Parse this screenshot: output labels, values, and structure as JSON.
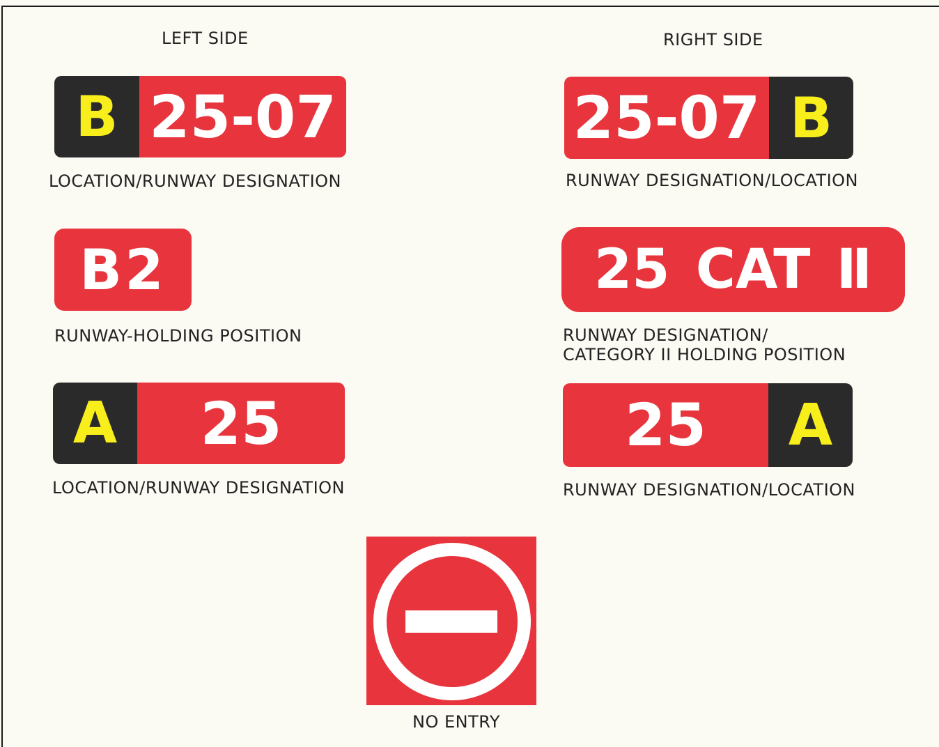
{
  "headings": {
    "left": "LEFT SIDE",
    "right": "RIGHT SIDE"
  },
  "signs": {
    "left_loc_rwy": {
      "location": "B",
      "runway": "25-07",
      "caption": "LOCATION/RUNWAY DESIGNATION"
    },
    "right_rwy_loc": {
      "runway": "25-07",
      "location": "B",
      "caption": "RUNWAY DESIGNATION/LOCATION"
    },
    "holding": {
      "text": "B2",
      "caption": "RUNWAY-HOLDING POSITION"
    },
    "cat2": {
      "text": "25 CAT Ⅱ",
      "caption_line1": "RUNWAY DESIGNATION/",
      "caption_line2": "CATEGORY II HOLDING POSITION"
    },
    "left_loc_rwy_2": {
      "location": "A",
      "runway": "25",
      "caption": "LOCATION/RUNWAY DESIGNATION"
    },
    "right_rwy_loc_2": {
      "runway": "25",
      "location": "A",
      "caption": "RUNWAY DESIGNATION/LOCATION"
    },
    "no_entry": {
      "icon": "no-entry-icon",
      "caption": "NO ENTRY"
    }
  },
  "colors": {
    "mandatory_red": "#e8353d",
    "location_black": "#2a2a2a",
    "location_yellow": "#f7ee1c",
    "legend_white": "#ffffff"
  }
}
